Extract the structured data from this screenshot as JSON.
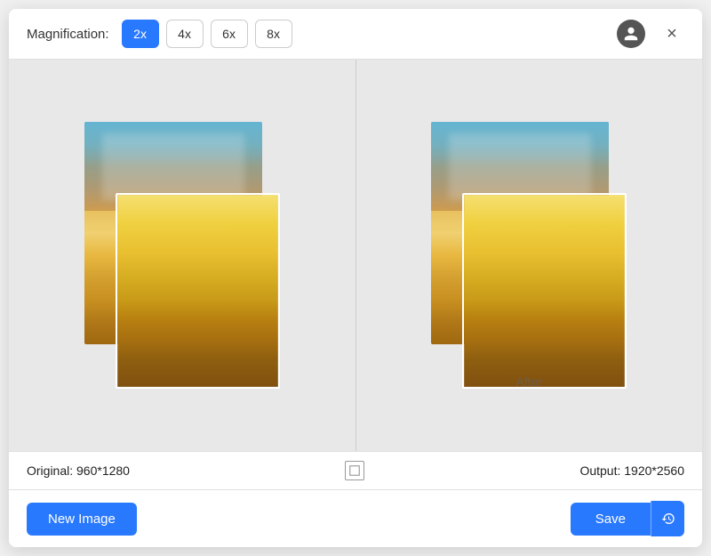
{
  "header": {
    "magnification_label": "Magnification:",
    "mag_options": [
      {
        "label": "2x",
        "active": true
      },
      {
        "label": "4x",
        "active": false
      },
      {
        "label": "6x",
        "active": false
      },
      {
        "label": "8x",
        "active": false
      }
    ],
    "close_label": "×"
  },
  "image_area": {
    "after_label": "After"
  },
  "info_bar": {
    "original_label": "Original: 960*1280",
    "output_label": "Output: 1920*2560"
  },
  "footer": {
    "new_image_label": "New Image",
    "save_label": "Save"
  }
}
